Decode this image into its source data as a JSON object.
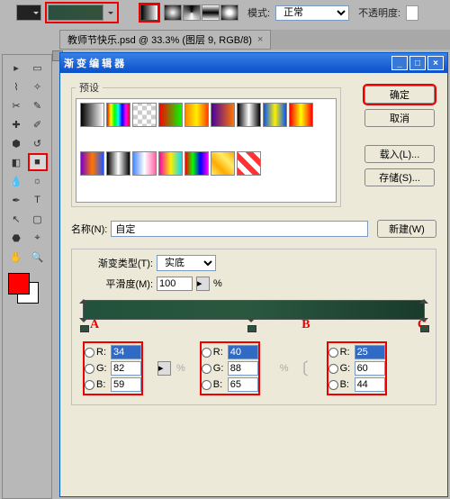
{
  "options_bar": {
    "mode_label": "模式:",
    "mode_value": "正常",
    "opacity_label": "不透明度:"
  },
  "doc_tab": {
    "title": "教师节快乐.psd @ 33.3% (图层 9, RGB/8)",
    "close": "×"
  },
  "fg_color": "#ff0000",
  "bg_color": "#ffffff",
  "dialog": {
    "title": "渐 变 编 辑 器",
    "presets_label": "预设",
    "ok": "确定",
    "cancel": "取消",
    "load": "载入(L)...",
    "save": "存储(S)...",
    "name_label": "名称(N):",
    "name_value": "自定",
    "new_btn": "新建(W)",
    "type_label": "渐变类型(T):",
    "type_value": "实底",
    "smooth_label": "平滑度(M):",
    "smooth_value": "100",
    "pct": "%"
  },
  "markers": {
    "a": "A",
    "b": "B",
    "c": "C"
  },
  "rgb": {
    "r_label": "R:",
    "g_label": "G:",
    "b_label": "B:",
    "A": {
      "r": "34",
      "g": "82",
      "b": "59"
    },
    "B": {
      "r": "40",
      "g": "88",
      "b": "65"
    },
    "C": {
      "r": "25",
      "g": "60",
      "b": "44"
    }
  },
  "presets": [
    "linear-gradient(to right,#000,#fff)",
    "linear-gradient(to right,#ff0000,#ffff00,#00ff00,#00ffff,#0000ff,#ff00ff,#ff0000)",
    "repeating-conic-gradient(#ccc 0 25%, #fff 0 50%) 0/10px 10px",
    "linear-gradient(to right,#ff0000,#00ff00)",
    "linear-gradient(to right,#ff8800,#ffee00,#ff4400)",
    "linear-gradient(to right,#4a00a0,#ff7700)",
    "linear-gradient(to right,#000,#fff,#000)",
    "linear-gradient(to right,#0054ff,#ffee00,#0054ff)",
    "linear-gradient(to right,#ff0000,#ffff00,#ff0000)",
    "linear-gradient(to right,#7a00cc,#ff7700,#2255ff)",
    "linear-gradient(to right,#000,#fff 50%,#000)",
    "linear-gradient(to right,#4a88ff,#fff,#ff66aa)",
    "linear-gradient(to right,#ff00aa,#ffee00,#00ddff)",
    "linear-gradient(to right,#ff0000,#00ff00,#0000ff,#ff00ff)",
    "linear-gradient(45deg,#ffee66,#ffaa00,#ffee66,#ffaa00)",
    "repeating-linear-gradient(45deg,#ff3333 0 6px,#fff 6px 12px)"
  ]
}
